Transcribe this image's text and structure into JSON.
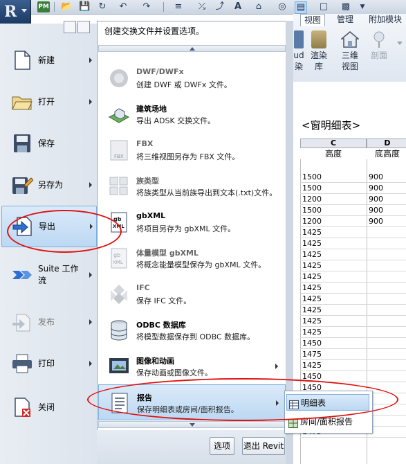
{
  "quick_access": {
    "icons": [
      "revit-logo-icon",
      "pm-icon",
      "open-icon",
      "save-icon",
      "sync-icon",
      "undo-icon",
      "redo-icon",
      "measure-icon",
      "dimension-icon",
      "text-icon",
      "home-icon",
      "view-icon",
      "switch-windows-icon",
      "qat-dropdown-icon"
    ],
    "pm_label": "PM",
    "text_tool": "A"
  },
  "ribbon": {
    "tabs": [
      "视图",
      "管理",
      "附加模块"
    ],
    "active_tab": "视图",
    "buttons": [
      {
        "label_line1": "ud",
        "label_line2": "染"
      },
      {
        "label_line1": "渲染",
        "label_line2": "库"
      },
      {
        "label_line1": "三维",
        "label_line2": "视图"
      },
      {
        "label_line1": "剖面",
        "label_line2": ""
      }
    ]
  },
  "app_menu": {
    "items": [
      {
        "label": "新建",
        "icon": "new-file-icon",
        "has_arrow": true,
        "disabled": false,
        "selected": false
      },
      {
        "label": "打开",
        "icon": "open-folder-icon",
        "has_arrow": true,
        "disabled": false,
        "selected": false
      },
      {
        "label": "保存",
        "icon": "save-disk-icon",
        "has_arrow": false,
        "disabled": false,
        "selected": false
      },
      {
        "label": "另存为",
        "icon": "save-as-icon",
        "has_arrow": true,
        "disabled": false,
        "selected": false
      },
      {
        "label": "导出",
        "icon": "export-icon",
        "has_arrow": true,
        "disabled": false,
        "selected": true
      },
      {
        "label": "Suite 工作流",
        "icon": "suite-workflow-icon",
        "has_arrow": true,
        "disabled": false,
        "selected": false
      },
      {
        "label": "发布",
        "icon": "publish-icon",
        "has_arrow": true,
        "disabled": true,
        "selected": false
      },
      {
        "label": "打印",
        "icon": "printer-icon",
        "has_arrow": true,
        "disabled": false,
        "selected": false
      },
      {
        "label": "关闭",
        "icon": "close-doc-icon",
        "has_arrow": false,
        "disabled": false,
        "selected": false
      }
    ]
  },
  "export_panel": {
    "title": "创建交换文件并设置选项。",
    "items": [
      {
        "title": "DWF/DWFx",
        "desc": "创建 DWF 或 DWFx 文件。",
        "icon": "dwf-icon",
        "disabled": true,
        "has_arrow": false
      },
      {
        "title": "建筑场地",
        "desc": "导出 ADSK 交换文件。",
        "icon": "building-site-icon",
        "disabled": false,
        "has_arrow": false
      },
      {
        "title": "FBX",
        "desc": "将三维视图另存为 FBX 文件。",
        "icon": "fbx-icon",
        "disabled": true,
        "has_arrow": false
      },
      {
        "title": "族类型",
        "desc": "将族类型从当前族导出到文本(.txt)文件。",
        "icon": "family-types-icon",
        "disabled": true,
        "has_arrow": false
      },
      {
        "title": "gbXML",
        "desc": "将项目另存为 gbXML 文件。",
        "icon": "gbxml-icon",
        "disabled": false,
        "has_arrow": false
      },
      {
        "title": "体量模型 gbXML",
        "desc": "将概念能量模型保存为 gbXML 文件。",
        "icon": "mass-gbxml-icon",
        "disabled": true,
        "has_arrow": false
      },
      {
        "title": "IFC",
        "desc": "保存 IFC 文件。",
        "icon": "ifc-icon",
        "disabled": true,
        "has_arrow": false
      },
      {
        "title": "ODBC 数据库",
        "desc": "将模型数据保存到 ODBC 数据库。",
        "icon": "database-icon",
        "disabled": false,
        "has_arrow": false
      },
      {
        "title": "图像和动画",
        "desc": "保存动画或图像文件。",
        "icon": "film-icon",
        "disabled": false,
        "has_arrow": true
      },
      {
        "title": "报告",
        "desc": "保存明细表或房间/面积报告。",
        "icon": "report-icon",
        "disabled": false,
        "has_arrow": true,
        "selected": true
      }
    ],
    "options_button": "选项",
    "exit_button": "退出 Revit"
  },
  "flyout": {
    "items": [
      {
        "label": "明细表",
        "icon": "schedule-icon",
        "selected": true
      },
      {
        "label": "房间/面积报告",
        "icon": "room-area-report-icon",
        "selected": false
      }
    ]
  },
  "schedule": {
    "title": "<窗明细表>",
    "columns": [
      {
        "letter": "C",
        "header": "高度"
      },
      {
        "letter": "D",
        "header": "底高度"
      }
    ],
    "heights": [
      "1500",
      "1500",
      "1200",
      "1500",
      "1200",
      "1425",
      "1425",
      "1425",
      "1425",
      "1425",
      "1425",
      "1425",
      "1425",
      "1425",
      "1425",
      "1450",
      "1475",
      "1425",
      "1450",
      "1450",
      "1450",
      "1450",
      "1475",
      "1475"
    ],
    "sill_heights": [
      "900",
      "900",
      "900",
      "900",
      "900"
    ]
  },
  "colors": {
    "annotation_red": "#e01010",
    "selection_blue": "#bcd8f3"
  }
}
